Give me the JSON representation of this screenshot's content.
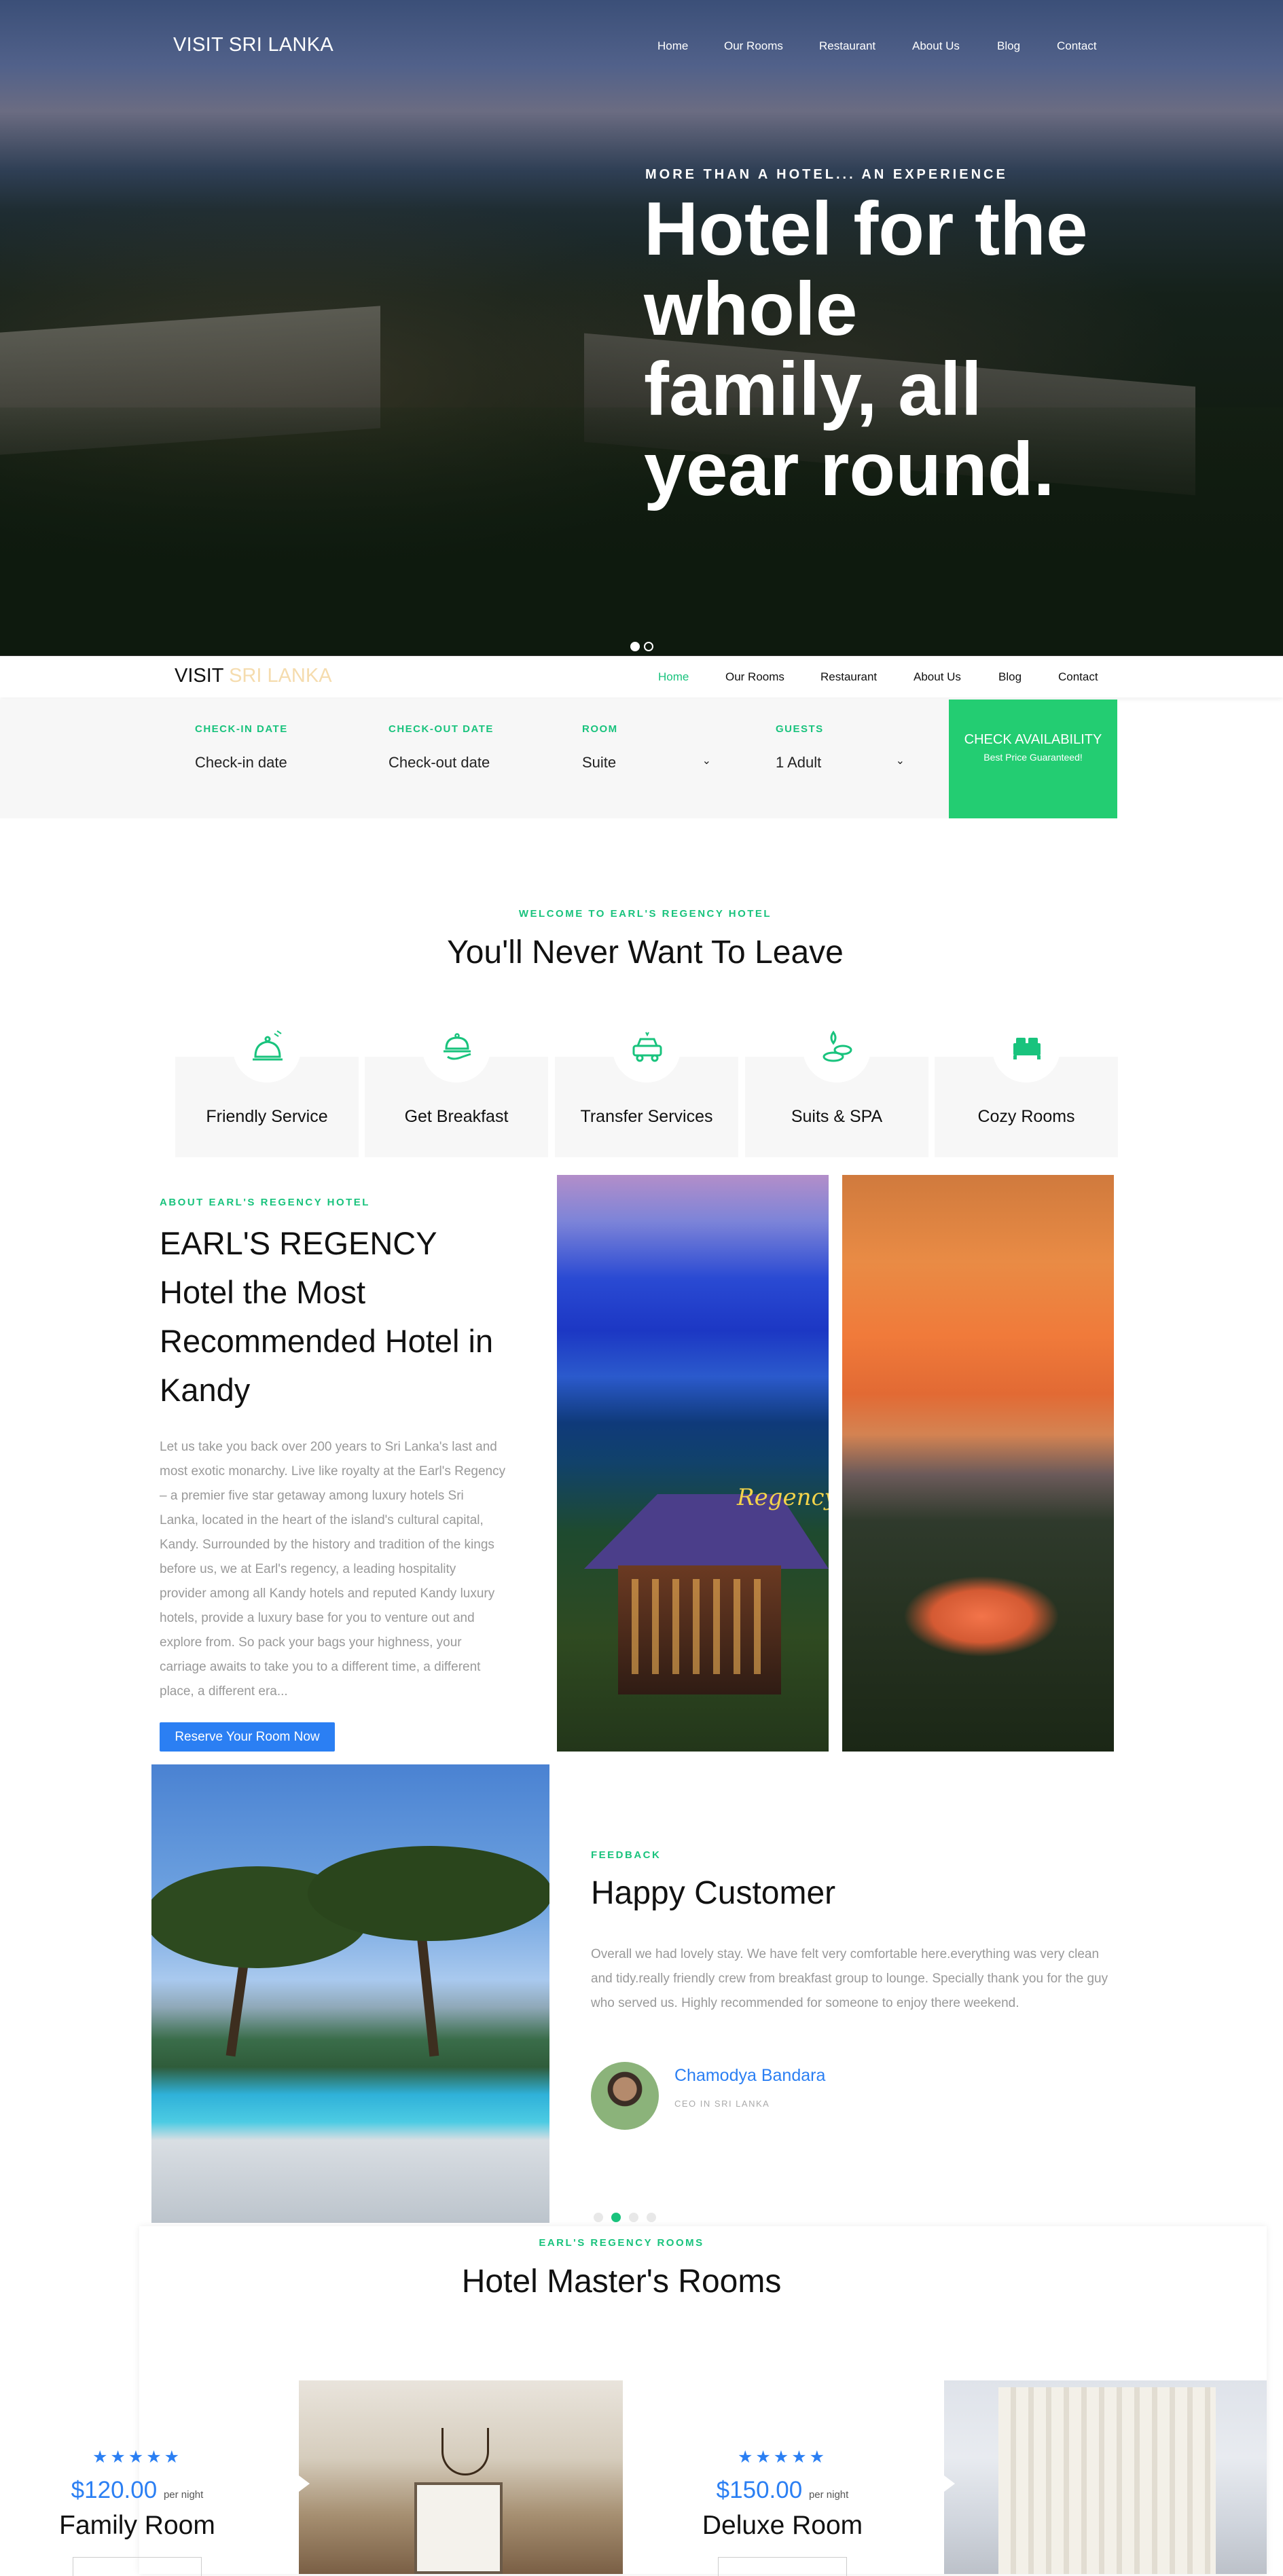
{
  "nav": {
    "logo": "VISIT SRI LANKA",
    "logo_part1": "VISIT",
    "logo_part2": "SRI LANKA",
    "items": [
      "Home",
      "Our Rooms",
      "Restaurant",
      "About Us",
      "Blog",
      "Contact"
    ],
    "active": "Home"
  },
  "hero": {
    "eyebrow": "MORE THAN A HOTEL... AN EXPERIENCE",
    "title_lines": [
      "Hotel for the",
      "whole",
      "family, all",
      "year round."
    ]
  },
  "booking": {
    "checkin": {
      "label": "CHECK-IN DATE",
      "placeholder": "Check-in date"
    },
    "checkout": {
      "label": "CHECK-OUT DATE",
      "placeholder": "Check-out date"
    },
    "room": {
      "label": "ROOM",
      "value": "Suite"
    },
    "guests": {
      "label": "GUESTS",
      "value": "1 Adult"
    },
    "button": {
      "title": "CHECK AVAILABILITY",
      "subtitle": "Best Price Guaranteed!"
    }
  },
  "welcome": {
    "eyebrow": "WELCOME TO EARL'S REGENCY HOTEL",
    "title": "You'll Never Want To Leave",
    "services": [
      {
        "label": "Friendly Service",
        "icon": "service-bell-icon"
      },
      {
        "label": "Get Breakfast",
        "icon": "food-tray-icon"
      },
      {
        "label": "Transfer Services",
        "icon": "car-icon"
      },
      {
        "label": "Suits & SPA",
        "icon": "spa-icon"
      },
      {
        "label": "Cozy Rooms",
        "icon": "bed-icon"
      }
    ]
  },
  "about": {
    "eyebrow": "ABOUT EARL'S REGENCY HOTEL",
    "title_lines": [
      "EARL'S REGENCY",
      "Hotel the Most",
      "Recommended Hotel in",
      "Kandy"
    ],
    "text": "Let us take you back over 200 years to Sri Lanka's last and most exotic monarchy. Live like royalty at the Earl's Regency – a premier five star getaway among luxury hotels Sri Lanka, located in the heart of the island's cultural capital, Kandy. Surrounded by the history and tradition of the kings before us, we at Earl's regency, a leading hospitality provider among all Kandy hotels and reputed Kandy luxury hotels, provide a luxury base for you to venture out and explore from. So pack your bags your highness, your carriage awaits to take you to a different time, a different place, a different era...",
    "button": "Reserve Your Room Now",
    "image_sign": "Regency"
  },
  "feedback": {
    "eyebrow": "FEEDBACK",
    "title": "Happy Customer",
    "text": "Overall we had lovely stay. We have felt very comfortable here.everything was very clean and tidy.really friendly crew from breakfast group to lounge. Specially thank you for the guy who served us. Highly recommended for someone to enjoy there weekend.",
    "name": "Chamodya Bandara",
    "role": "CEO IN SRI LANKA",
    "slides": 4,
    "active_slide": 2
  },
  "rooms": {
    "eyebrow": "EARL'S REGENCY ROOMS",
    "title": "Hotel Master's Rooms",
    "items": [
      {
        "stars": "★★★★★",
        "price": "$120.00",
        "per": "per night",
        "name": "Family Room"
      },
      {
        "stars": "★★★★★",
        "price": "$150.00",
        "per": "per night",
        "name": "Deluxe Room"
      }
    ]
  },
  "colors": {
    "accent": "#19c37d",
    "primary": "#2b7ff3",
    "check_button": "#23cd72",
    "logo_light": "#f5dcae"
  }
}
